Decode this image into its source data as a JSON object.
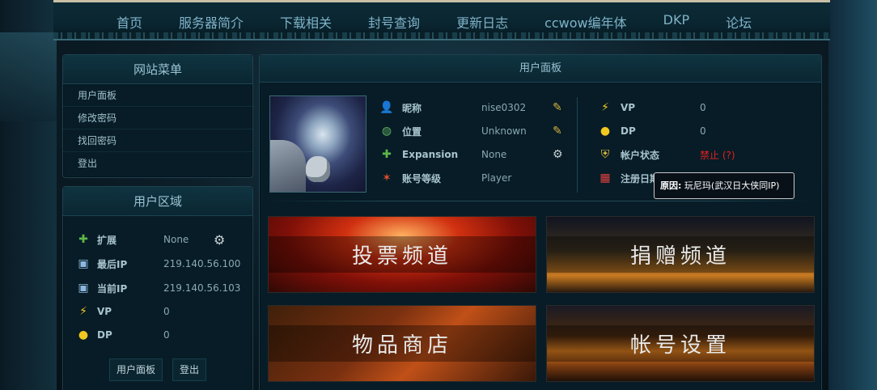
{
  "nav": [
    "首页",
    "服务器简介",
    "下载相关",
    "封号查询",
    "更新日志",
    "ccwow编年体",
    "DKP",
    "论坛"
  ],
  "menu": {
    "title": "网站菜单",
    "items": [
      "用户面板",
      "修改密码",
      "找回密码",
      "登出"
    ]
  },
  "user_area": {
    "title": "用户区域",
    "rows": [
      {
        "icon": "puzzle-icon",
        "label": "扩展",
        "value": "None"
      },
      {
        "icon": "monitor-icon",
        "label": "最后IP",
        "value": "219.140.56.100"
      },
      {
        "icon": "monitor-icon",
        "label": "当前IP",
        "value": "219.140.56.103"
      },
      {
        "icon": "lightning-icon",
        "label": "VP",
        "value": "0"
      },
      {
        "icon": "coins-icon",
        "label": "DP",
        "value": "0"
      }
    ],
    "buttons": [
      "用户面板",
      "登出"
    ]
  },
  "main": {
    "title": "用户面板",
    "left_rows": [
      {
        "icon": "user-icon",
        "label": "昵称",
        "value": "nise0302",
        "action": "pencil-icon"
      },
      {
        "icon": "globe-icon",
        "label": "位置",
        "value": "Unknown",
        "action": "pencil-icon"
      },
      {
        "icon": "puzzle-icon",
        "label": "Expansion",
        "value": "None",
        "action": "gear-icon"
      },
      {
        "icon": "star-icon",
        "label": "账号等级",
        "value": "Player",
        "action": ""
      }
    ],
    "right_rows": [
      {
        "icon": "lightning-icon",
        "label": "VP",
        "value": "0"
      },
      {
        "icon": "coins-icon",
        "label": "DP",
        "value": "0"
      },
      {
        "icon": "shield-icon",
        "label": "帐户状态",
        "value": "禁止 (?)"
      },
      {
        "icon": "calendar-icon",
        "label": "注册日期",
        "value": ""
      }
    ],
    "status_color": "#e02020",
    "tooltip": {
      "prefix": "原因:",
      "text": "玩尼玛(武汉日大侠同IP)"
    },
    "tiles": [
      "投票频道",
      "捐赠频道",
      "物品商店",
      "帐号设置"
    ]
  }
}
